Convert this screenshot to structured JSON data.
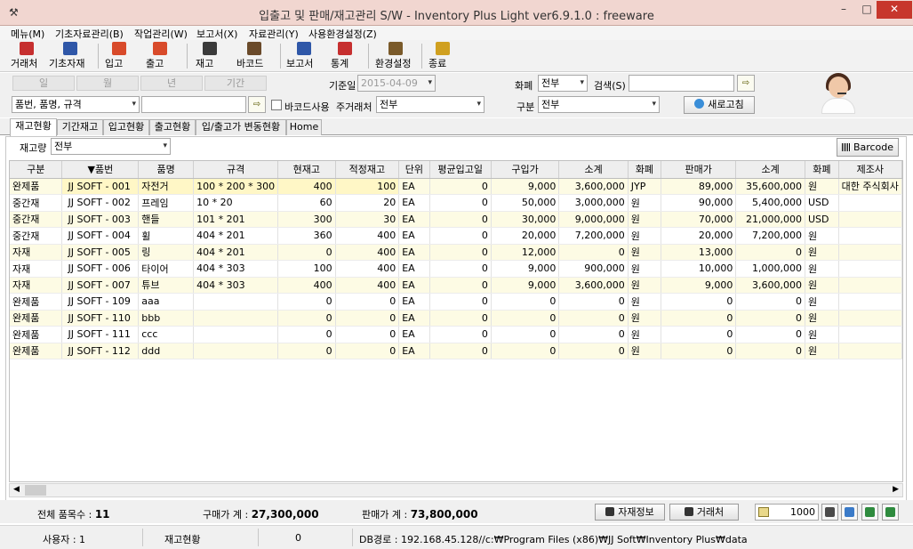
{
  "window": {
    "title": "입출고 및 판매/재고관리 S/W - Inventory Plus Light ver6.9.1.0 : freeware",
    "app_icon": "tool-icon",
    "min": "–",
    "max": "□",
    "close": "✕"
  },
  "menu": [
    "메뉴(M)",
    "기초자료관리(B)",
    "작업관리(W)",
    "보고서(X)",
    "자료관리(Y)",
    "사용환경설정(Z)"
  ],
  "toolbar": [
    {
      "label": "거래처",
      "icon": "trade-partner-icon",
      "color": "#c62f2f"
    },
    {
      "label": "기초자재",
      "icon": "materials-icon",
      "color": "#2f57a8"
    },
    {
      "label": "입고",
      "icon": "inbound-icon",
      "color": "#d84a2a"
    },
    {
      "label": "출고",
      "icon": "outbound-icon",
      "color": "#d84a2a"
    },
    {
      "label": "재고",
      "icon": "stock-icon",
      "color": "#3a3a3a"
    },
    {
      "label": "바코드",
      "icon": "barcode-icon",
      "color": "#6a4a2a"
    },
    {
      "label": "보고서",
      "icon": "report-icon",
      "color": "#2f57a8"
    },
    {
      "label": "통계",
      "icon": "stats-icon",
      "color": "#c62f2f"
    },
    {
      "label": "환경설정",
      "icon": "settings-icon",
      "color": "#7a5a2a"
    },
    {
      "label": "종료",
      "icon": "exit-icon",
      "color": "#d0a020"
    }
  ],
  "period_buttons": [
    "일",
    "월",
    "년",
    "기간"
  ],
  "filters": {
    "base_date_label": "기준일",
    "base_date": "2015-04-09",
    "currency_label": "화폐",
    "currency": "전부",
    "search_label": "검색(S)",
    "search_value": "",
    "search_scope": "품번, 품명, 규격",
    "keyword_value": "",
    "barcode_use_label": "바코드사용",
    "main_partner_label": "주거래처",
    "main_partner": "전부",
    "category_label": "구분",
    "category": "전부",
    "refresh_label": "새로고침"
  },
  "tabs": [
    "재고현황",
    "기간재고",
    "입고현황",
    "출고현황",
    "입/출고가 변동현황",
    "Home"
  ],
  "active_tab": 0,
  "panel": {
    "qty_label": "재고량",
    "qty_value": "전부",
    "barcode_button": "Barcode"
  },
  "table": {
    "columns": [
      "구분",
      "▼품번",
      "품명",
      "규격",
      "현재고",
      "적정재고",
      "단위",
      "평균입고일",
      "구입가",
      "소계",
      "화폐",
      "판매가",
      "소계",
      "화폐",
      "제조사"
    ],
    "rows": [
      [
        "완제품",
        "JJ SOFT - 001",
        "자전거",
        "100 * 200 * 300",
        "400",
        "100",
        "EA",
        "0",
        "9,000",
        "3,600,000",
        "JYP",
        "89,000",
        "35,600,000",
        "원",
        "대한 주식회사"
      ],
      [
        "중간재",
        "JJ SOFT - 002",
        "프레임",
        "10 * 20",
        "60",
        "20",
        "EA",
        "0",
        "50,000",
        "3,000,000",
        "원",
        "90,000",
        "5,400,000",
        "USD",
        ""
      ],
      [
        "중간재",
        "JJ SOFT - 003",
        "핸들",
        "101 * 201",
        "300",
        "30",
        "EA",
        "0",
        "30,000",
        "9,000,000",
        "원",
        "70,000",
        "21,000,000",
        "USD",
        ""
      ],
      [
        "중간재",
        "JJ SOFT - 004",
        "휠",
        "404 * 201",
        "360",
        "400",
        "EA",
        "0",
        "20,000",
        "7,200,000",
        "원",
        "20,000",
        "7,200,000",
        "원",
        ""
      ],
      [
        "자재",
        "JJ SOFT - 005",
        "링",
        "404 * 201",
        "0",
        "400",
        "EA",
        "0",
        "12,000",
        "0",
        "원",
        "13,000",
        "0",
        "원",
        ""
      ],
      [
        "자재",
        "JJ SOFT - 006",
        "타이어",
        "404 * 303",
        "100",
        "400",
        "EA",
        "0",
        "9,000",
        "900,000",
        "원",
        "10,000",
        "1,000,000",
        "원",
        ""
      ],
      [
        "자재",
        "JJ SOFT - 007",
        "튜브",
        "404 * 303",
        "400",
        "400",
        "EA",
        "0",
        "9,000",
        "3,600,000",
        "원",
        "9,000",
        "3,600,000",
        "원",
        ""
      ],
      [
        "완제품",
        "JJ SOFT - 109",
        "aaa",
        "",
        "0",
        "0",
        "EA",
        "0",
        "0",
        "0",
        "원",
        "0",
        "0",
        "원",
        ""
      ],
      [
        "완제품",
        "JJ SOFT - 110",
        "bbb",
        "",
        "0",
        "0",
        "EA",
        "0",
        "0",
        "0",
        "원",
        "0",
        "0",
        "원",
        ""
      ],
      [
        "완제품",
        "JJ SOFT - 111",
        "ccc",
        "",
        "0",
        "0",
        "EA",
        "0",
        "0",
        "0",
        "원",
        "0",
        "0",
        "원",
        ""
      ],
      [
        "완제품",
        "JJ SOFT - 112",
        "ddd",
        "",
        "0",
        "0",
        "EA",
        "0",
        "0",
        "0",
        "원",
        "0",
        "0",
        "원",
        ""
      ]
    ]
  },
  "summary": {
    "total_items_label": "전체 품목수 :",
    "total_items": "11",
    "purchase_total_label": "구매가 계 :",
    "purchase_total": "27,300,000",
    "sales_total_label": "판매가 계 :",
    "sales_total": "73,800,000",
    "material_info_button": "자재정보",
    "partner_button": "거래처",
    "page_size": "1000"
  },
  "status": {
    "user": "사용자 : 1",
    "view": "재고현황",
    "count": "0",
    "db_path": "DB경로 : 192.168.45.128//c:₩Program Files (x86)₩JJ Soft₩Inventory Plus₩data"
  }
}
